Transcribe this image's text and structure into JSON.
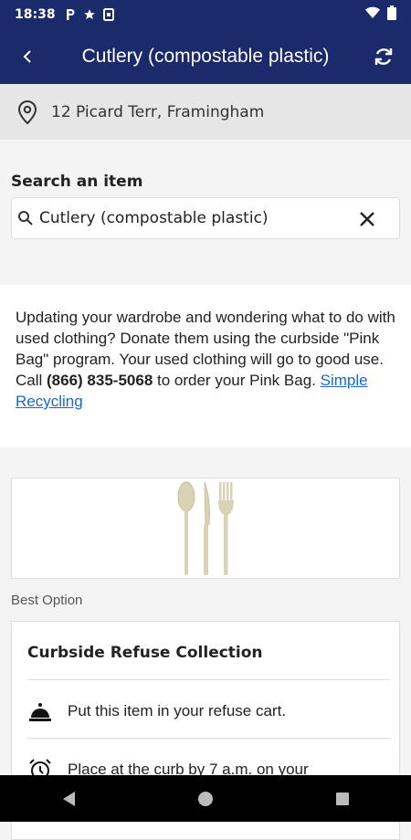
{
  "status": {
    "time": "18:38",
    "notif_icons": [
      "parking-icon",
      "star-icon",
      "card-icon"
    ],
    "right_icons": [
      "wifi-icon",
      "battery-icon"
    ]
  },
  "header": {
    "title": "Cutlery (compostable plastic)",
    "back_icon": "chevron-left-icon",
    "refresh_icon": "refresh-icon",
    "bg_color": "#1b2a6b"
  },
  "address": {
    "text": "12 Picard Terr, Framingham",
    "icon": "location-pin-icon"
  },
  "search": {
    "label": "Search an item",
    "value": "Cutlery (compostable plastic)",
    "search_icon": "search-icon",
    "clear_icon": "close-icon"
  },
  "info": {
    "text1": "Updating your wardrobe and wondering what to do with used clothing? Donate them using the curbside \"Pink Bag\" program. Your used clothing will go to good use. Call ",
    "phone": "(866) 835-5068",
    "text2": " to order your Pink Bag. ",
    "link": "Simple Recycling",
    "link_color": "#1a66d6"
  },
  "item_image": {
    "description_icon": "cutlery-icon"
  },
  "best_option": {
    "label": "Best Option",
    "card_title": "Curbside Refuse Collection",
    "steps": [
      {
        "icon": "bell-icon",
        "text": "Put this item in your refuse cart."
      },
      {
        "icon": "alarm-clock-icon",
        "text": "Place at the curb by 7 a.m. on your"
      }
    ]
  },
  "navbar": {
    "buttons": [
      "back-nav-icon",
      "home-nav-icon",
      "recents-nav-icon"
    ]
  }
}
